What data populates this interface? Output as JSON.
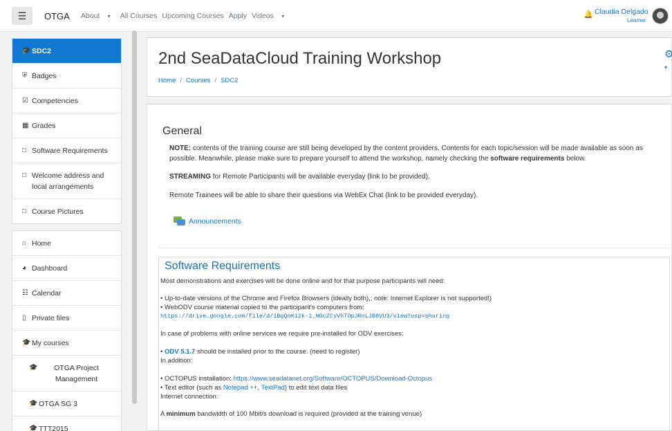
{
  "topbar": {
    "menu_icon": "hamburger-icon",
    "brand": "OTGA",
    "nav": [
      {
        "label": "About",
        "dropdown": true
      },
      {
        "label": "All Courses",
        "dropdown": false
      },
      {
        "label": "Upcoming Courses",
        "dropdown": false
      },
      {
        "label": "Apply",
        "dropdown": false
      },
      {
        "label": "Videos",
        "dropdown": true
      }
    ],
    "user_name": "Claudia Delgado",
    "user_role": "Learner"
  },
  "sidebar": {
    "course_block": [
      {
        "icon": "graduation-cap-icon",
        "label": "SDC2",
        "active": true
      },
      {
        "icon": "shield-icon",
        "label": "Badges"
      },
      {
        "icon": "checkbox-icon",
        "label": "Competencies"
      },
      {
        "icon": "table-icon",
        "label": "Grades"
      },
      {
        "icon": "folder-icon",
        "label": "Software Requirements"
      },
      {
        "icon": "folder-icon",
        "label": "Welcome address and local arrangements"
      },
      {
        "icon": "folder-icon",
        "label": "Course Pictures"
      }
    ],
    "nav_block": [
      {
        "icon": "home-icon",
        "label": "Home"
      },
      {
        "icon": "dashboard-icon",
        "label": "Dashboard"
      },
      {
        "icon": "calendar-icon",
        "label": "Calendar"
      },
      {
        "icon": "file-icon",
        "label": "Private files"
      },
      {
        "icon": "graduation-cap-icon",
        "label": "My courses"
      },
      {
        "icon": "graduation-cap-icon",
        "label": "OTGA Project Management",
        "sub": true
      },
      {
        "icon": "graduation-cap-icon",
        "label": "OTGA SG 3",
        "sub": true
      },
      {
        "icon": "graduation-cap-icon",
        "label": "TTT2015",
        "sub": true
      }
    ]
  },
  "header": {
    "title": "2nd SeaDataCloud Training Workshop",
    "breadcrumb": [
      "Home",
      "Courses",
      "SDC2"
    ]
  },
  "general": {
    "title": "General",
    "note_label": "NOTE:",
    "note_text_1": "contents of the training course are still being developed by the content providers. Contents for each topic/session will be made available as soon as possible. Meanwhile, please make sure to prepare yourself to attend the workshop, namely checking the",
    "note_bold": "software requirements",
    "note_text_2": "below.",
    "streaming_label": "STREAMING",
    "streaming_text": "for Remote Participants will be available everyday (link to be provided).",
    "remote_text": "Remote Trainees will be able to share their questions via WebEx  Chat (link to be provided everyday).",
    "announcements": "Announcements"
  },
  "software": {
    "title": "Software Requirements",
    "intro": "Most demonstrations and exercises will be done online and for that purpose participants will need:",
    "bullet1": "• Up-to-date versions of the Chrome and Firefox Browsers (ideally  both),; note: Internet Explorer is not supported!)",
    "bullet2": "• WebODV course material copied to the participant's computers from:",
    "drive_url": "https://drive.google.com/file/d/1BgQnKi2k-1_NOcZCyVhTOpJRnLJB8VU3/view?usp=sharing",
    "problems": "In case of problems with online services we require pre-installed for ODV exercises:",
    "odv_bullet": "• ",
    "odv_link": "ODV 5.1.7",
    "odv_text": " should be installed prior to the course. (need to register)",
    "in_addition": "In addition:",
    "octopus_label": "• OCTOPUS installation: ",
    "octopus_url": "https://www.seadatanet.org/Software/OCTOPUS/Download-Octopus",
    "editor_label": "• Text editor (such as ",
    "notepad": "Notepad ++",
    "comma": ", ",
    "textpad": "TextPad",
    "editor_tail": ") to edit text data files",
    "internet": "Internet connection:",
    "minimum_pre": "A ",
    "minimum_bold": "minimum",
    "minimum_tail": " bandwidth of 100 Mbit/s download is required (provided at the training venue)"
  }
}
